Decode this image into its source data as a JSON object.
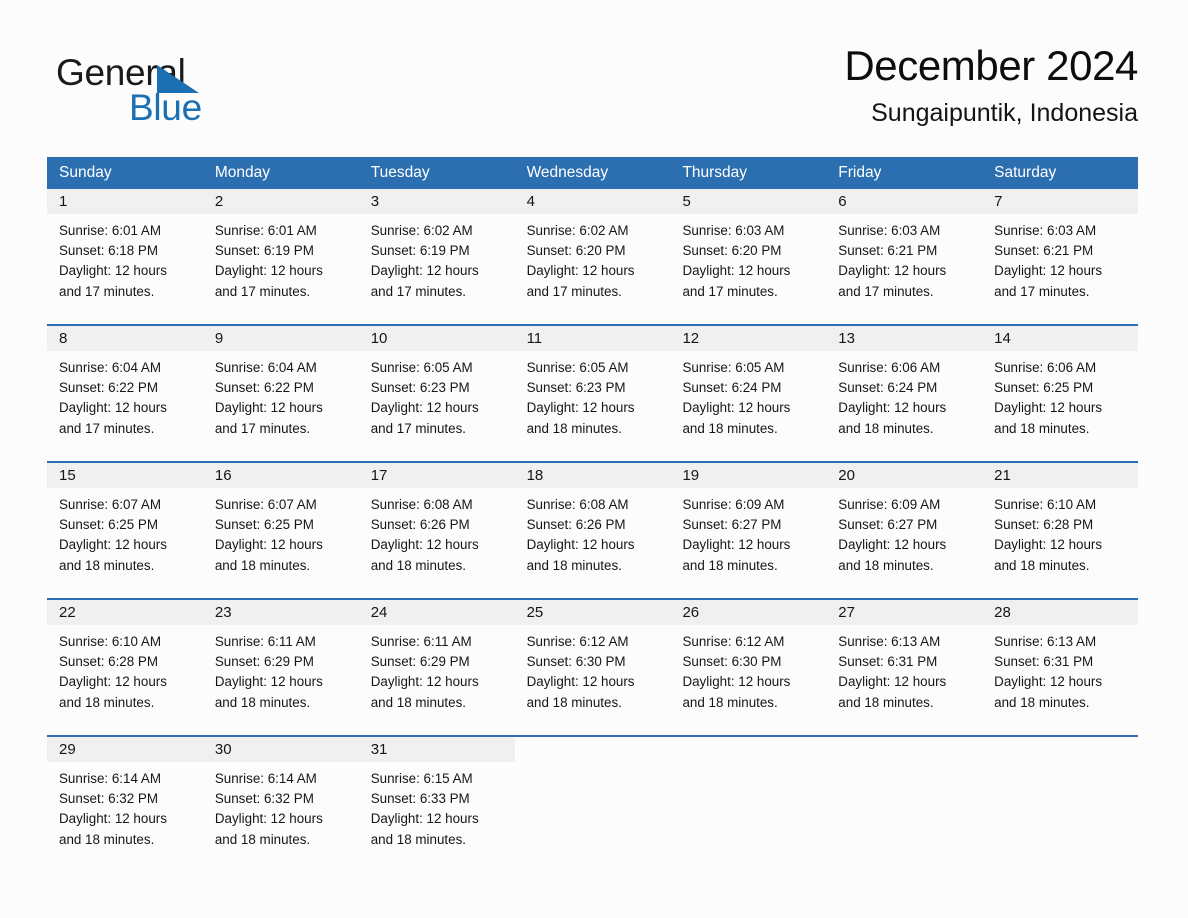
{
  "brand": {
    "name_part1": "General",
    "name_part2": "Blue",
    "accent_color": "#1b6fb3",
    "triangle_icon": "brand-triangle-icon"
  },
  "header": {
    "title": "December 2024",
    "subtitle": "Sungaipuntik, Indonesia"
  },
  "theme": {
    "header_blue": "#2c6fb1",
    "daynum_band": "#f0f0f0",
    "page_background": "#fcfcfc",
    "text": "#161616"
  },
  "calendar": {
    "weekday_headers": [
      "Sunday",
      "Monday",
      "Tuesday",
      "Wednesday",
      "Thursday",
      "Friday",
      "Saturday"
    ],
    "weeks": [
      [
        {
          "day": "1",
          "lines": [
            "Sunrise: 6:01 AM",
            "Sunset: 6:18 PM",
            "Daylight: 12 hours",
            "and 17 minutes."
          ]
        },
        {
          "day": "2",
          "lines": [
            "Sunrise: 6:01 AM",
            "Sunset: 6:19 PM",
            "Daylight: 12 hours",
            "and 17 minutes."
          ]
        },
        {
          "day": "3",
          "lines": [
            "Sunrise: 6:02 AM",
            "Sunset: 6:19 PM",
            "Daylight: 12 hours",
            "and 17 minutes."
          ]
        },
        {
          "day": "4",
          "lines": [
            "Sunrise: 6:02 AM",
            "Sunset: 6:20 PM",
            "Daylight: 12 hours",
            "and 17 minutes."
          ]
        },
        {
          "day": "5",
          "lines": [
            "Sunrise: 6:03 AM",
            "Sunset: 6:20 PM",
            "Daylight: 12 hours",
            "and 17 minutes."
          ]
        },
        {
          "day": "6",
          "lines": [
            "Sunrise: 6:03 AM",
            "Sunset: 6:21 PM",
            "Daylight: 12 hours",
            "and 17 minutes."
          ]
        },
        {
          "day": "7",
          "lines": [
            "Sunrise: 6:03 AM",
            "Sunset: 6:21 PM",
            "Daylight: 12 hours",
            "and 17 minutes."
          ]
        }
      ],
      [
        {
          "day": "8",
          "lines": [
            "Sunrise: 6:04 AM",
            "Sunset: 6:22 PM",
            "Daylight: 12 hours",
            "and 17 minutes."
          ]
        },
        {
          "day": "9",
          "lines": [
            "Sunrise: 6:04 AM",
            "Sunset: 6:22 PM",
            "Daylight: 12 hours",
            "and 17 minutes."
          ]
        },
        {
          "day": "10",
          "lines": [
            "Sunrise: 6:05 AM",
            "Sunset: 6:23 PM",
            "Daylight: 12 hours",
            "and 17 minutes."
          ]
        },
        {
          "day": "11",
          "lines": [
            "Sunrise: 6:05 AM",
            "Sunset: 6:23 PM",
            "Daylight: 12 hours",
            "and 18 minutes."
          ]
        },
        {
          "day": "12",
          "lines": [
            "Sunrise: 6:05 AM",
            "Sunset: 6:24 PM",
            "Daylight: 12 hours",
            "and 18 minutes."
          ]
        },
        {
          "day": "13",
          "lines": [
            "Sunrise: 6:06 AM",
            "Sunset: 6:24 PM",
            "Daylight: 12 hours",
            "and 18 minutes."
          ]
        },
        {
          "day": "14",
          "lines": [
            "Sunrise: 6:06 AM",
            "Sunset: 6:25 PM",
            "Daylight: 12 hours",
            "and 18 minutes."
          ]
        }
      ],
      [
        {
          "day": "15",
          "lines": [
            "Sunrise: 6:07 AM",
            "Sunset: 6:25 PM",
            "Daylight: 12 hours",
            "and 18 minutes."
          ]
        },
        {
          "day": "16",
          "lines": [
            "Sunrise: 6:07 AM",
            "Sunset: 6:25 PM",
            "Daylight: 12 hours",
            "and 18 minutes."
          ]
        },
        {
          "day": "17",
          "lines": [
            "Sunrise: 6:08 AM",
            "Sunset: 6:26 PM",
            "Daylight: 12 hours",
            "and 18 minutes."
          ]
        },
        {
          "day": "18",
          "lines": [
            "Sunrise: 6:08 AM",
            "Sunset: 6:26 PM",
            "Daylight: 12 hours",
            "and 18 minutes."
          ]
        },
        {
          "day": "19",
          "lines": [
            "Sunrise: 6:09 AM",
            "Sunset: 6:27 PM",
            "Daylight: 12 hours",
            "and 18 minutes."
          ]
        },
        {
          "day": "20",
          "lines": [
            "Sunrise: 6:09 AM",
            "Sunset: 6:27 PM",
            "Daylight: 12 hours",
            "and 18 minutes."
          ]
        },
        {
          "day": "21",
          "lines": [
            "Sunrise: 6:10 AM",
            "Sunset: 6:28 PM",
            "Daylight: 12 hours",
            "and 18 minutes."
          ]
        }
      ],
      [
        {
          "day": "22",
          "lines": [
            "Sunrise: 6:10 AM",
            "Sunset: 6:28 PM",
            "Daylight: 12 hours",
            "and 18 minutes."
          ]
        },
        {
          "day": "23",
          "lines": [
            "Sunrise: 6:11 AM",
            "Sunset: 6:29 PM",
            "Daylight: 12 hours",
            "and 18 minutes."
          ]
        },
        {
          "day": "24",
          "lines": [
            "Sunrise: 6:11 AM",
            "Sunset: 6:29 PM",
            "Daylight: 12 hours",
            "and 18 minutes."
          ]
        },
        {
          "day": "25",
          "lines": [
            "Sunrise: 6:12 AM",
            "Sunset: 6:30 PM",
            "Daylight: 12 hours",
            "and 18 minutes."
          ]
        },
        {
          "day": "26",
          "lines": [
            "Sunrise: 6:12 AM",
            "Sunset: 6:30 PM",
            "Daylight: 12 hours",
            "and 18 minutes."
          ]
        },
        {
          "day": "27",
          "lines": [
            "Sunrise: 6:13 AM",
            "Sunset: 6:31 PM",
            "Daylight: 12 hours",
            "and 18 minutes."
          ]
        },
        {
          "day": "28",
          "lines": [
            "Sunrise: 6:13 AM",
            "Sunset: 6:31 PM",
            "Daylight: 12 hours",
            "and 18 minutes."
          ]
        }
      ],
      [
        {
          "day": "29",
          "lines": [
            "Sunrise: 6:14 AM",
            "Sunset: 6:32 PM",
            "Daylight: 12 hours",
            "and 18 minutes."
          ]
        },
        {
          "day": "30",
          "lines": [
            "Sunrise: 6:14 AM",
            "Sunset: 6:32 PM",
            "Daylight: 12 hours",
            "and 18 minutes."
          ]
        },
        {
          "day": "31",
          "lines": [
            "Sunrise: 6:15 AM",
            "Sunset: 6:33 PM",
            "Daylight: 12 hours",
            "and 18 minutes."
          ]
        },
        {
          "day": "",
          "lines": []
        },
        {
          "day": "",
          "lines": []
        },
        {
          "day": "",
          "lines": []
        },
        {
          "day": "",
          "lines": []
        }
      ]
    ]
  }
}
